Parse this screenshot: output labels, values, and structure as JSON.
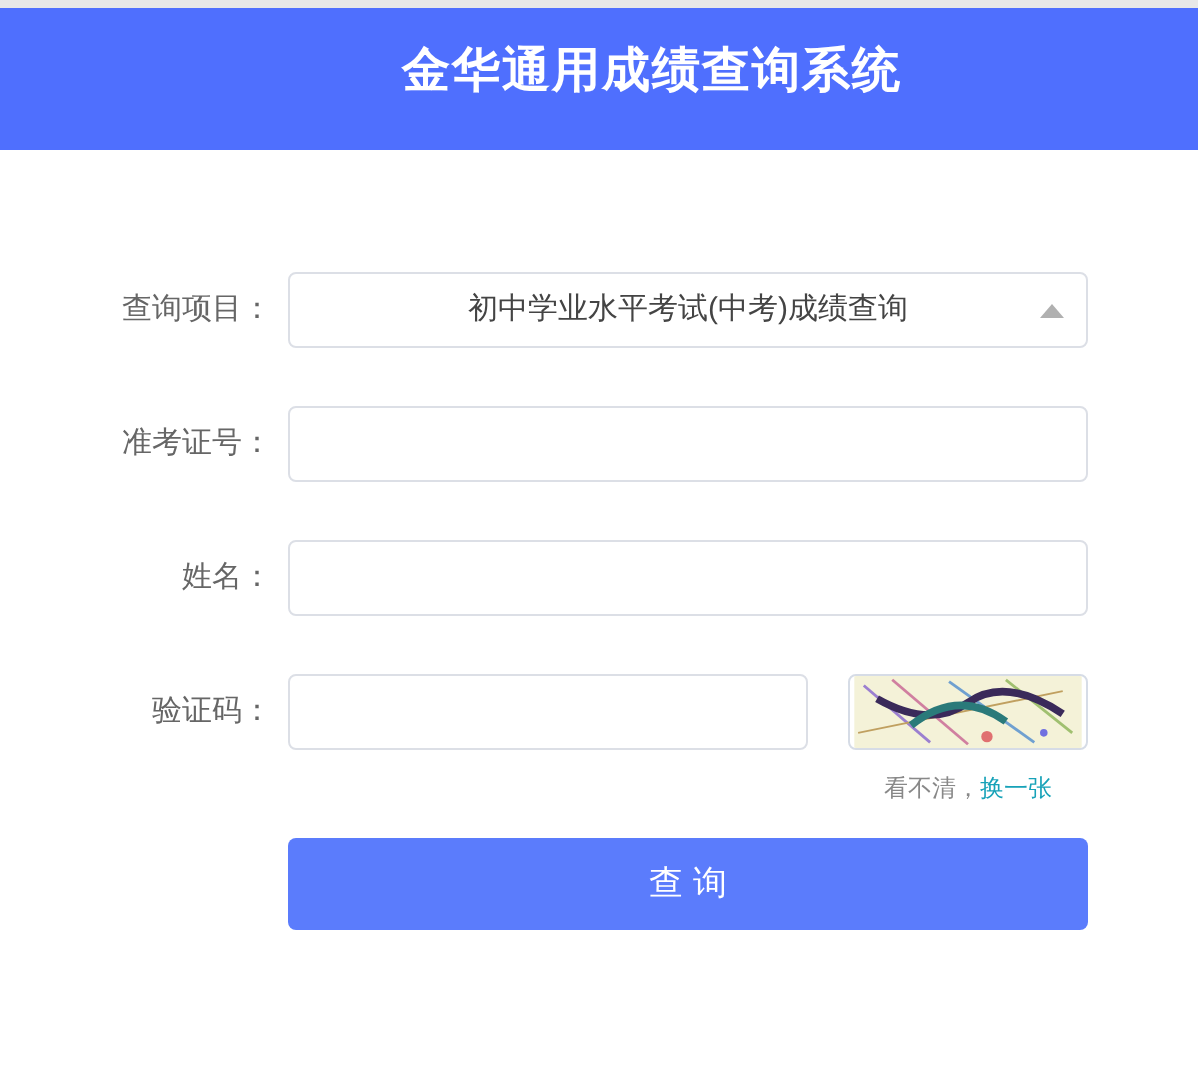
{
  "header": {
    "title": "金华通用成绩查询系统"
  },
  "form": {
    "fields": [
      {
        "kind": "select",
        "label": "查询项目：",
        "value": "初中学业水平考试(中考)成绩查询"
      },
      {
        "kind": "text",
        "label": "准考证号："
      },
      {
        "kind": "text",
        "label": "姓名："
      },
      {
        "kind": "captcha",
        "label": "验证码：",
        "refresh_hint": "看不清，",
        "refresh_link": "换一张"
      }
    ],
    "submit": "查 询"
  }
}
